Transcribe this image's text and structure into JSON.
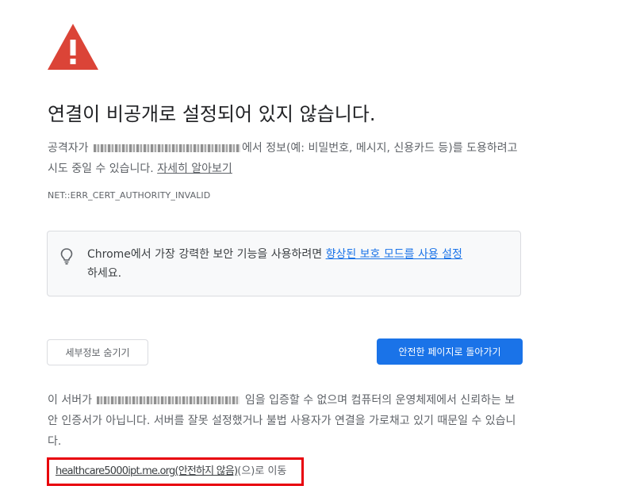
{
  "title": "연결이 비공개로 설정되어 있지 않습니다.",
  "description": {
    "prefix": "공격자가",
    "suffix": "에서 정보(예: 비밀번호, 메시지, 신용카드 등)를 도용하려고 시도 중일 수 있습니다.",
    "learn_more": "자세히 알아보기"
  },
  "error_code": "NET::ERR_CERT_AUTHORITY_INVALID",
  "info_box": {
    "icon": "lightbulb-icon",
    "prefix": "Chrome에서 가장 강력한 보안 기능을 사용하려면",
    "link": "향상된 보호 모드를 사용 설정",
    "suffix": "하세요."
  },
  "buttons": {
    "details": "세부정보 숨기기",
    "back": "안전한 페이지로 돌아가기"
  },
  "details": {
    "prefix": "이 서버가",
    "suffix": "임을 입증할 수 없으며 컴퓨터의 운영체제에서 신뢰하는 보안 인증서가 아닙니다. 서버를 잘못 설정했거나 불법 사용자가 연결을 가로채고 있기 때문일 수 있습니다."
  },
  "proceed": {
    "host": "healthcare5000ipt.me.org(안전하지 않음)",
    "suffix": "(으)로 이동"
  },
  "colors": {
    "warning_red": "#db4437",
    "primary_blue": "#1a73e8",
    "highlight_border": "#e8000b"
  }
}
